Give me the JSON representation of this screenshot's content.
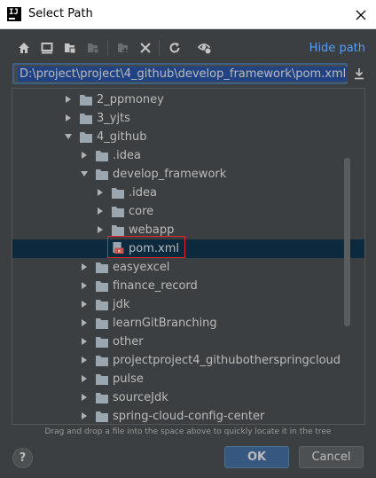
{
  "window": {
    "title": "Select Path",
    "app_icon_text": "IJ"
  },
  "toolbar": {
    "buttons": [
      "home-icon",
      "desktop-icon",
      "project-icon",
      "module-icon",
      "new-folder-icon",
      "delete-icon",
      "refresh-icon",
      "show-hidden-icon"
    ],
    "hide_path_label": "Hide path"
  },
  "path_field": {
    "value": "D:\\project\\project\\4_github\\develop_framework\\pom.xml"
  },
  "tree": {
    "rows": [
      {
        "label": "2_ppmoney",
        "kind": "folder",
        "depth": 3,
        "expanded": false
      },
      {
        "label": "3_yjts",
        "kind": "folder",
        "depth": 3,
        "expanded": false
      },
      {
        "label": "4_github",
        "kind": "folder",
        "depth": 3,
        "expanded": true
      },
      {
        "label": ".idea",
        "kind": "folder",
        "depth": 4,
        "expanded": false
      },
      {
        "label": "develop_framework",
        "kind": "folder",
        "depth": 4,
        "expanded": true
      },
      {
        "label": ".idea",
        "kind": "folder",
        "depth": 5,
        "expanded": false
      },
      {
        "label": "core",
        "kind": "folder",
        "depth": 5,
        "expanded": false
      },
      {
        "label": "webapp",
        "kind": "folder",
        "depth": 5,
        "expanded": false
      },
      {
        "label": "pom.xml",
        "kind": "file",
        "depth": 5,
        "selected": true
      },
      {
        "label": "easyexcel",
        "kind": "folder",
        "depth": 4,
        "expanded": false
      },
      {
        "label": "finance_record",
        "kind": "folder",
        "depth": 4,
        "expanded": false
      },
      {
        "label": "jdk",
        "kind": "folder",
        "depth": 4,
        "expanded": false
      },
      {
        "label": "learnGitBranching",
        "kind": "folder",
        "depth": 4,
        "expanded": false
      },
      {
        "label": "other",
        "kind": "folder",
        "depth": 4,
        "expanded": false
      },
      {
        "label": "projectproject4_githubotherspringcloud",
        "kind": "folder",
        "depth": 4,
        "expanded": false
      },
      {
        "label": "pulse",
        "kind": "folder",
        "depth": 4,
        "expanded": false
      },
      {
        "label": "sourceJdk",
        "kind": "folder",
        "depth": 4,
        "expanded": false
      },
      {
        "label": "spring-cloud-config-center",
        "kind": "folder",
        "depth": 4,
        "expanded": false
      }
    ]
  },
  "hint": "Drag and drop a file into the space above to quickly locate it in the tree",
  "buttons": {
    "help_label": "?",
    "ok_label": "OK",
    "cancel_label": "Cancel"
  },
  "colors": {
    "background": "#3c3f41",
    "accent_link": "#589df6",
    "selection_bg": "#0d293e",
    "path_selection": "#214283",
    "highlight_box": "#e0252c",
    "folder": "#9aa7b0",
    "primary_button": "#365880"
  }
}
